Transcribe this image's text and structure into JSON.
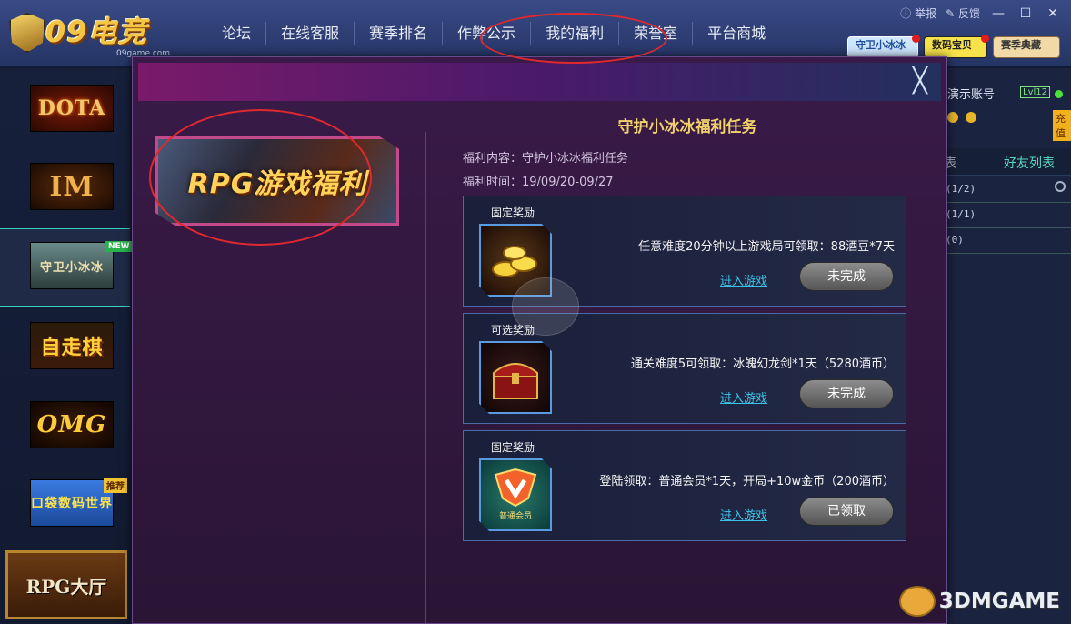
{
  "app": {
    "logo_text": "09电竞",
    "logo_sub": "09game.com"
  },
  "nav": {
    "items": [
      "论坛",
      "在线客服",
      "赛季排名",
      "作弊公示",
      "我的福利",
      "荣誉室",
      "平台商城"
    ]
  },
  "top_actions": {
    "report": "举报",
    "feedback": "反馈",
    "minimize": "—",
    "maximize": "☐",
    "close": "✕"
  },
  "top_badges": [
    "守卫小冰冰",
    "数码宝贝",
    "赛季典藏"
  ],
  "left_games": {
    "dota": "DOTA",
    "im": "IM",
    "shouwei": "守卫小冰冰",
    "new_badge": "NEW",
    "zizou": "自走棋",
    "omg": "OMG",
    "koudai": "口袋数码世界",
    "tuijian_badge": "推荐",
    "rpg_hall": "RPG大厅"
  },
  "right_panel": {
    "account": "演示账号",
    "level": "Lvl12",
    "charge": "充值",
    "tab_left": "表",
    "tab_right": "好友列表",
    "rows": [
      "(1/2)",
      "(1/1)",
      "(0)"
    ]
  },
  "dialog": {
    "close_icon": "╳",
    "banner_text": "RPG游戏福利",
    "task_title": "守护小冰冰福利任务",
    "content_line": "福利内容：守护小冰冰福利任务",
    "time_line": "福利时间：19/09/20-09/27",
    "rewards": [
      {
        "type": "固定奖励",
        "icon": "gold-ingots-icon",
        "desc": "任意难度20分钟以上游戏局可领取：88酒豆*7天",
        "link": "进入游戏",
        "button": "未完成"
      },
      {
        "type": "可选奖励",
        "icon": "treasure-chest-icon",
        "desc": "通关难度5可领取：冰魄幻龙剑*1天（5280酒币）",
        "link": "进入游戏",
        "button": "未完成"
      },
      {
        "type": "固定奖励",
        "icon": "vip-badge-icon",
        "vip_label": "普通会员",
        "desc": "登陆领取：普通会员*1天，开局+10w金币（200酒币）",
        "link": "进入游戏",
        "button": "已领取"
      }
    ]
  },
  "watermark": "3DMGAME",
  "colors": {
    "title_gold": "#f2d26a",
    "link_cyan": "#3ec3e8",
    "highlight_red": "#e0282f",
    "border_blue": "#4a6aa8"
  }
}
